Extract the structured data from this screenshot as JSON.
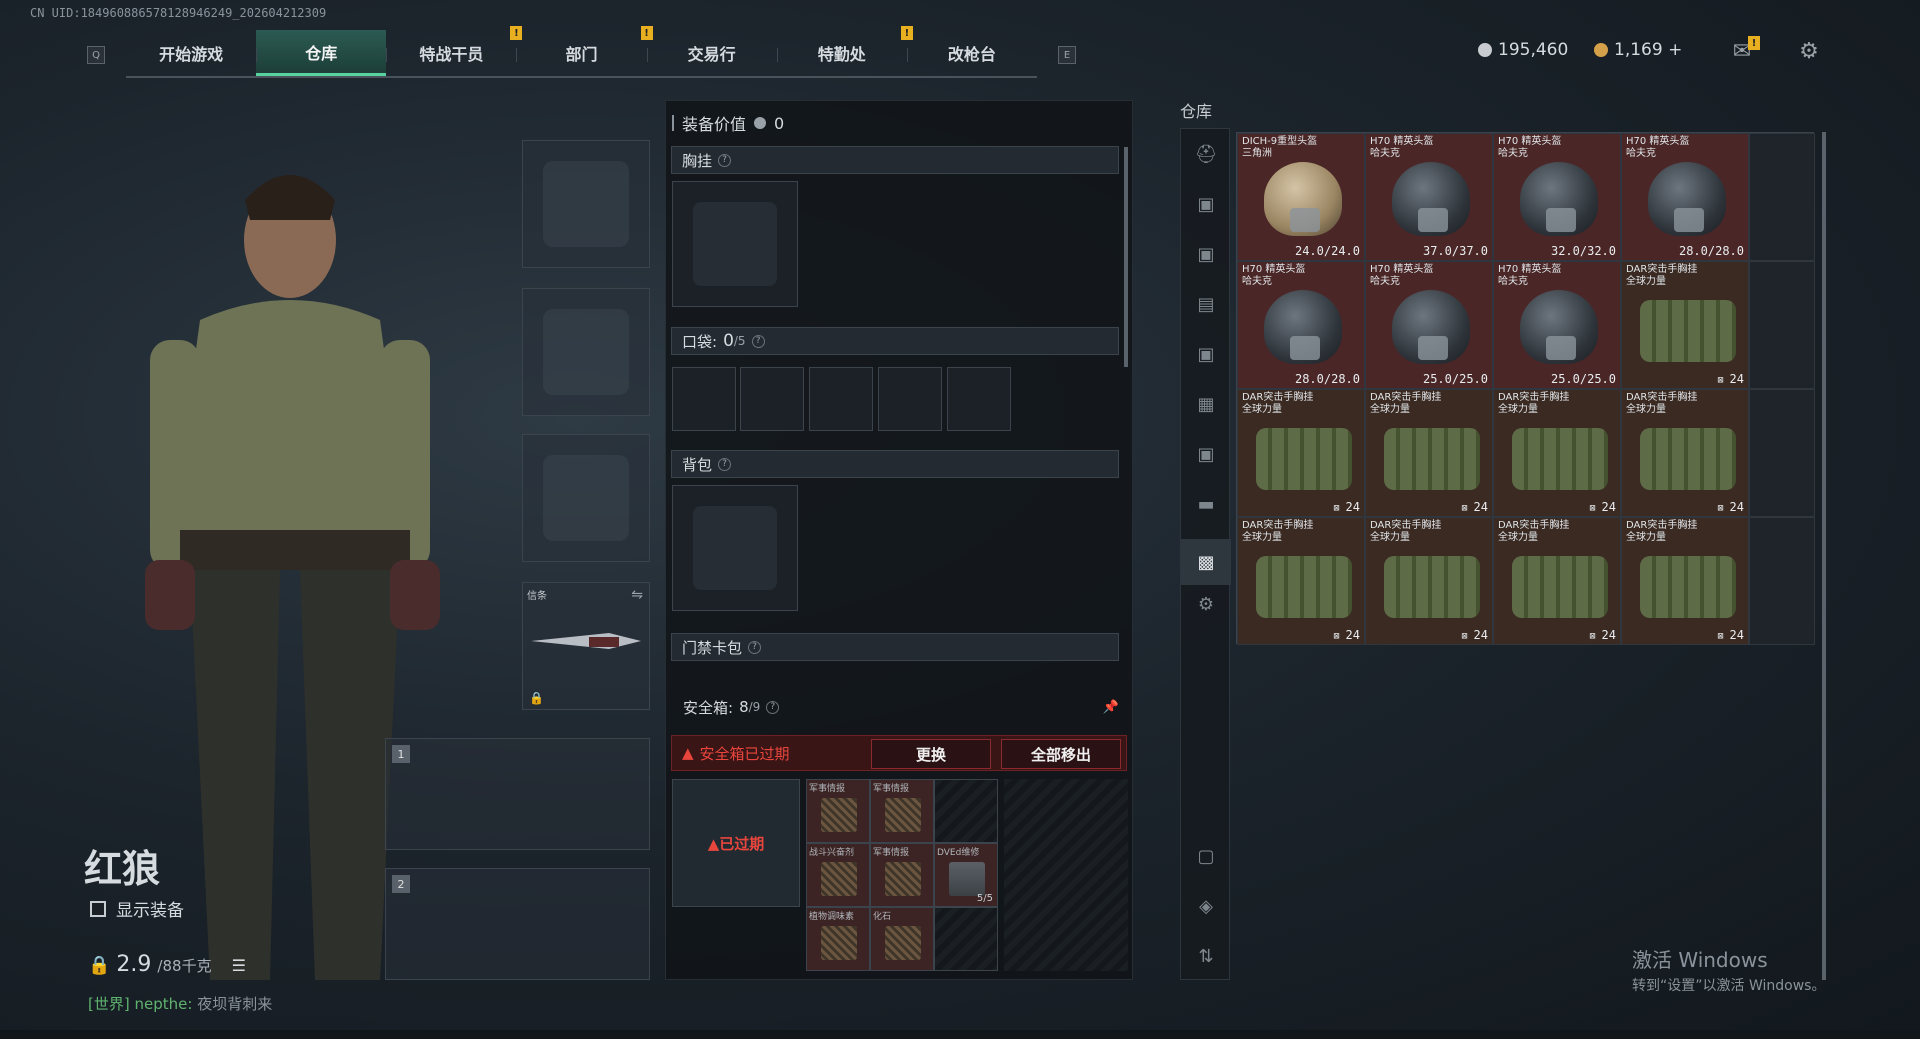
{
  "uid": "CN UID:184960886578128946249_202604212309",
  "nav": {
    "left_key": "Q",
    "right_key": "E",
    "tabs": [
      {
        "label": "开始游戏",
        "active": false,
        "notif": false
      },
      {
        "label": "仓库",
        "active": true,
        "notif": false
      },
      {
        "label": "特战干员",
        "active": false,
        "notif": true
      },
      {
        "label": "部门",
        "active": false,
        "notif": true
      },
      {
        "label": "交易行",
        "active": false,
        "notif": false
      },
      {
        "label": "特勤处",
        "active": false,
        "notif": true
      },
      {
        "label": "改枪台",
        "active": false,
        "notif": false
      }
    ],
    "notif_glyph": "!"
  },
  "currency": {
    "silver": "195,460",
    "gold": "1,169 +",
    "silver_color": "#c8ccd0",
    "gold_color": "#d4a14a"
  },
  "character": {
    "name": "红狼",
    "show_equipment": "显示装备",
    "weight_value": "2.9",
    "weight_unit": "/88千克",
    "chat_channel": "[世界]",
    "chat_user": "nepthe:",
    "chat_message": "夜坝背刺来"
  },
  "slots": {
    "melee_label": "信条",
    "weapon_1": "1",
    "weapon_2": "2"
  },
  "middle": {
    "value_label": "装备价值",
    "value": "0",
    "chest_rig": "胸挂",
    "pocket_label": "口袋:",
    "pocket_used": "0",
    "pocket_total": "/5",
    "backpack": "背包",
    "keycard": "门禁卡包",
    "help": "?",
    "safe_label": "安全箱:",
    "safe_used": "8",
    "safe_total": "/9",
    "expired_warning": "安全箱已过期",
    "replace_button": "更换",
    "move_all_button": "全部移出",
    "case_tag": "已过期",
    "safe_items": [
      {
        "name": "军事情报",
        "type": "doc",
        "qty": ""
      },
      {
        "name": "军事情报",
        "type": "doc",
        "qty": ""
      },
      {
        "name": "",
        "type": "empty",
        "qty": ""
      },
      {
        "name": "战斗兴奋剂",
        "type": "doc",
        "qty": ""
      },
      {
        "name": "军事情报",
        "type": "doc",
        "qty": ""
      },
      {
        "name": "DVEd维修",
        "type": "dur",
        "qty": "5/5"
      },
      {
        "name": "植物调味素",
        "type": "doc",
        "qty": ""
      },
      {
        "name": "化石",
        "type": "doc",
        "qty": ""
      },
      {
        "name": "",
        "type": "empty",
        "qty": ""
      }
    ]
  },
  "warehouse": {
    "title": "仓库",
    "items": [
      {
        "name1": "DICH-9重型头盔",
        "name2": "三角洲",
        "value": "24.0/24.0",
        "kind": "helm-tan"
      },
      {
        "name1": "H70 精英头盔",
        "name2": "哈夫克",
        "value": "37.0/37.0",
        "kind": "helm"
      },
      {
        "name1": "H70 精英头盔",
        "name2": "哈夫克",
        "value": "32.0/32.0",
        "kind": "helm"
      },
      {
        "name1": "H70 精英头盔",
        "name2": "哈夫克",
        "value": "28.0/28.0",
        "kind": "helm"
      },
      {
        "name1": "",
        "name2": "",
        "value": "",
        "kind": "filler"
      },
      {
        "name1": "H70 精英头盔",
        "name2": "哈夫克",
        "value": "28.0/28.0",
        "kind": "helm"
      },
      {
        "name1": "H70 精英头盔",
        "name2": "哈夫克",
        "value": "25.0/25.0",
        "kind": "helm"
      },
      {
        "name1": "H70 精英头盔",
        "name2": "哈夫克",
        "value": "25.0/25.0",
        "kind": "helm"
      },
      {
        "name1": "DAR突击手胸挂",
        "name2": "全球力量",
        "value": "24",
        "kind": "rig"
      },
      {
        "name1": "",
        "name2": "",
        "value": "",
        "kind": "filler"
      },
      {
        "name1": "DAR突击手胸挂",
        "name2": "全球力量",
        "value": "24",
        "kind": "rig"
      },
      {
        "name1": "DAR突击手胸挂",
        "name2": "全球力量",
        "value": "24",
        "kind": "rig"
      },
      {
        "name1": "DAR突击手胸挂",
        "name2": "全球力量",
        "value": "24",
        "kind": "rig"
      },
      {
        "name1": "DAR突击手胸挂",
        "name2": "全球力量",
        "value": "24",
        "kind": "rig"
      },
      {
        "name1": "",
        "name2": "",
        "value": "",
        "kind": "filler"
      },
      {
        "name1": "DAR突击手胸挂",
        "name2": "全球力量",
        "value": "24",
        "kind": "rig"
      },
      {
        "name1": "DAR突击手胸挂",
        "name2": "全球力量",
        "value": "24",
        "kind": "rig"
      },
      {
        "name1": "DAR突击手胸挂",
        "name2": "全球力量",
        "value": "24",
        "kind": "rig"
      },
      {
        "name1": "DAR突击手胸挂",
        "name2": "全球力量",
        "value": "24",
        "kind": "rig"
      },
      {
        "name1": "",
        "name2": "",
        "value": "",
        "kind": "filler"
      }
    ],
    "side_icons": [
      "helmet-icon",
      "armor-icon-v",
      "armor-icon-v2",
      "folder-icon",
      "armor-icon-v3",
      "grid-icon",
      "armor-icon-iv",
      "gun-icon",
      "chest-rig-icon",
      "settings-icon",
      "safe-icon",
      "layers-icon",
      "sort-icon"
    ]
  },
  "windows": {
    "line1": "激活 Windows",
    "line2": "转到“设置”以激活 Windows。"
  }
}
